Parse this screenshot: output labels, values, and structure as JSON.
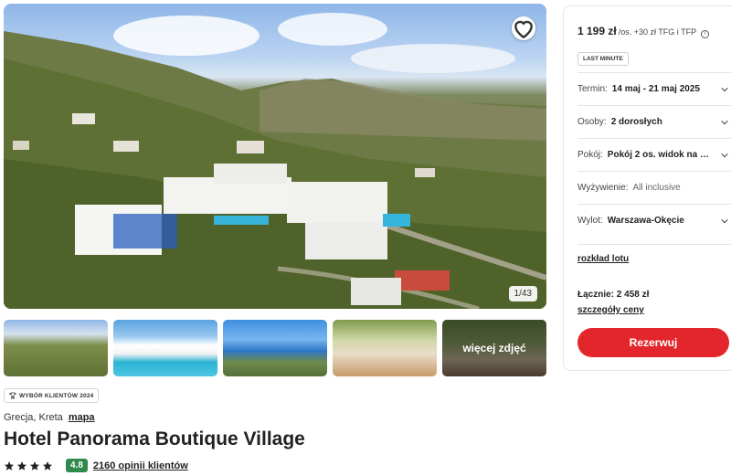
{
  "gallery": {
    "counter": "1/43",
    "more_label": "więcej zdjęć",
    "thumb_icons": [
      "hotel-aerial-photo",
      "pool-photo",
      "sea-view-photo",
      "room-photo",
      "room-2-photo"
    ]
  },
  "badge": {
    "label": "WYBÓR KLIENTÓW 2024",
    "icon": "trophy-icon"
  },
  "location": {
    "text": "Grecja, Kreta",
    "map_link": "mapa"
  },
  "hotel": {
    "name": "Hotel Panorama Boutique Village",
    "stars": 4,
    "score": "4.8",
    "reviews": "2160 opinii klientów"
  },
  "booking": {
    "price": "1 199 zł",
    "price_suffix": "/os. +30 zł TFG i TFP",
    "last_minute": "LAST MINUTE",
    "options": [
      {
        "label": "Termin:",
        "value": "14 maj - 21 maj 2025"
      },
      {
        "label": "Osoby:",
        "value": "2 dorosłych"
      },
      {
        "label": "Pokój:",
        "value": "Pokój 2 os. widok na m..."
      },
      {
        "label": "Wyżywienie:",
        "value": "All inclusive"
      },
      {
        "label": "Wylot:",
        "value": "Warszawa-Okęcie"
      }
    ],
    "flight_link": "rozkład lotu",
    "total": "Łącznie: 2 458 zł",
    "details_link": "szczegóły ceny",
    "book_button": "Rezerwuj"
  },
  "colors": {
    "accent": "#e3262b",
    "score_bg": "#2f8a4b"
  }
}
